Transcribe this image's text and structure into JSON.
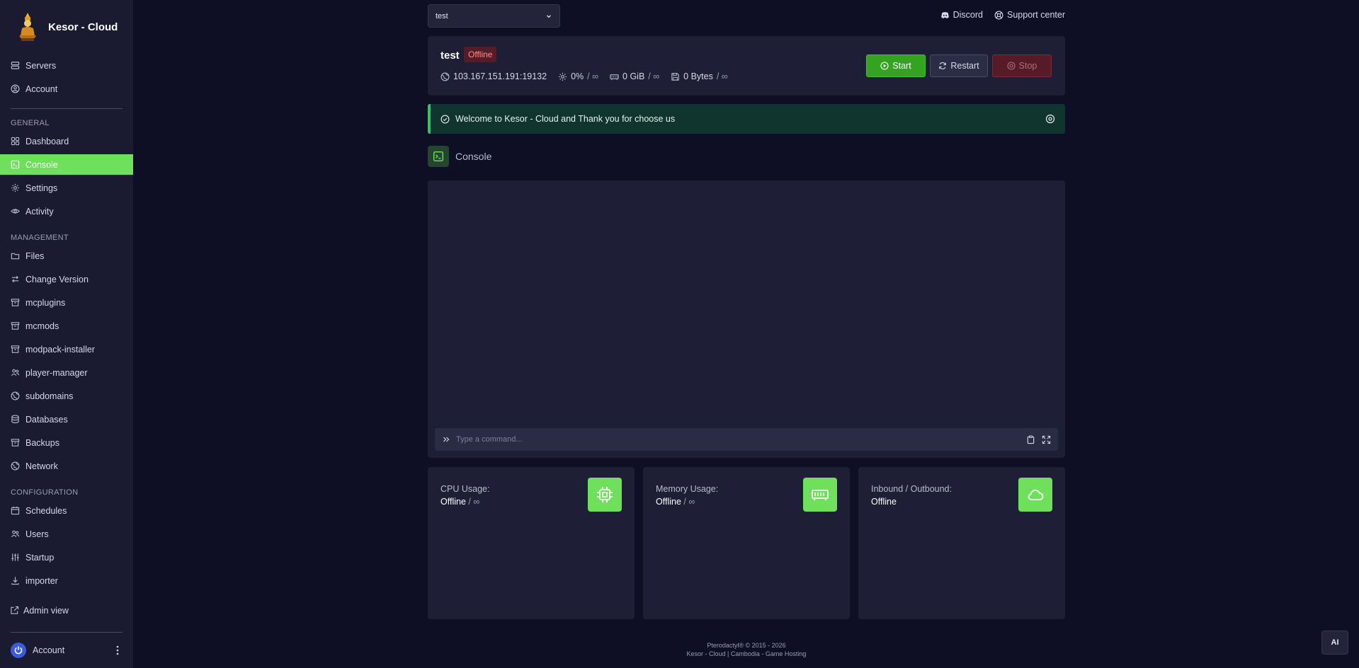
{
  "brand": {
    "name": "Kesor - Cloud"
  },
  "sidebar": {
    "top_items": [
      {
        "label": "Servers",
        "icon": "server-stack-icon"
      },
      {
        "label": "Account",
        "icon": "user-circle-icon"
      }
    ],
    "sections": {
      "general": "GENERAL",
      "management": "MANAGEMENT",
      "configuration": "CONFIGURATION"
    },
    "general_items": [
      {
        "label": "Dashboard",
        "icon": "grid-icon"
      },
      {
        "label": "Console",
        "icon": "terminal-icon",
        "active": true
      },
      {
        "label": "Settings",
        "icon": "gear-icon"
      },
      {
        "label": "Activity",
        "icon": "eye-icon"
      }
    ],
    "management_items": [
      {
        "label": "Files",
        "icon": "folder-icon"
      },
      {
        "label": "Change Version",
        "icon": "arrows-icon"
      },
      {
        "label": "mcplugins",
        "icon": "archive-icon"
      },
      {
        "label": "mcmods",
        "icon": "archive-icon"
      },
      {
        "label": "modpack-installer",
        "icon": "archive-icon"
      },
      {
        "label": "player-manager",
        "icon": "users-icon"
      },
      {
        "label": "subdomains",
        "icon": "globe-icon"
      },
      {
        "label": "Databases",
        "icon": "database-icon"
      },
      {
        "label": "Backups",
        "icon": "archive-icon"
      },
      {
        "label": "Network",
        "icon": "globe-icon"
      }
    ],
    "configuration_items": [
      {
        "label": "Schedules",
        "icon": "calendar-icon"
      },
      {
        "label": "Users",
        "icon": "users-icon"
      },
      {
        "label": "Startup",
        "icon": "sliders-icon"
      },
      {
        "label": "importer",
        "icon": "download-icon"
      }
    ],
    "admin_view": "Admin view",
    "account_footer": "Account"
  },
  "topbar": {
    "server_select": "test",
    "discord": "Discord",
    "support": "Support center"
  },
  "server": {
    "name": "test",
    "status": "Offline",
    "address": "103.167.151.191:19132",
    "cpu": "0%",
    "memory": "0 GiB",
    "disk": "0 Bytes",
    "limit": "/ ∞",
    "buttons": {
      "start": "Start",
      "restart": "Restart",
      "stop": "Stop"
    }
  },
  "alert": {
    "message": "Welcome to Kesor - Cloud and Thank you for choose us"
  },
  "console": {
    "title": "Console",
    "placeholder": "Type a command..."
  },
  "usage": [
    {
      "label": "CPU Usage:",
      "value": "Offline",
      "suffix": "/ ∞",
      "icon": "cpu-chip-icon"
    },
    {
      "label": "Memory Usage:",
      "value": "Offline",
      "suffix": "/ ∞",
      "icon": "memory-icon"
    },
    {
      "label": "Inbound / Outbound:",
      "value": "Offline",
      "suffix": "",
      "icon": "cloud-icon"
    }
  ],
  "footer": {
    "line1": "Pterodactyl® © 2015 - 2026",
    "line2": "Kesor - Cloud | Cambodia - Game Hosting"
  },
  "ai_button": "AI",
  "colors": {
    "accent": "#6ee05b",
    "background": "#0e0f24",
    "sidebar": "#1a1b31",
    "card": "#1e1f37",
    "offline": "#571b27",
    "start": "#34a320"
  }
}
